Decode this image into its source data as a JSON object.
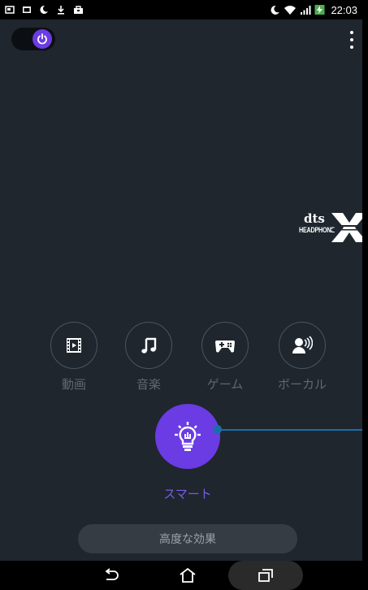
{
  "status_bar": {
    "time": "22:03",
    "left_icons": [
      "screenshot-icon",
      "gallery-icon",
      "moon-icon",
      "download-icon",
      "store-icon"
    ],
    "right_icons": [
      "moon-icon",
      "wifi-icon",
      "signal-icon",
      "battery-charging-icon"
    ]
  },
  "header": {
    "power_toggle_on": true,
    "menu_icon": "overflow-menu-icon"
  },
  "logo": {
    "brand": "dts",
    "product": "HEADPHONE"
  },
  "modes": [
    {
      "label": "動画",
      "icon": "film-icon"
    },
    {
      "label": "音楽",
      "icon": "music-note-icon"
    },
    {
      "label": "ゲーム",
      "icon": "gamepad-icon"
    },
    {
      "label": "ボーカル",
      "icon": "vocal-icon"
    }
  ],
  "smart": {
    "label": "スマート",
    "icon": "lightbulb-icon",
    "selected": true
  },
  "advanced_button": {
    "label": "高度な効果"
  },
  "nav": {
    "icons": [
      "back-icon",
      "home-icon",
      "recents-icon"
    ]
  },
  "colors": {
    "background": "#1f262e",
    "accent": "#6b3be4",
    "link_line": "#1a6ea8",
    "inactive": "#5f6873"
  }
}
